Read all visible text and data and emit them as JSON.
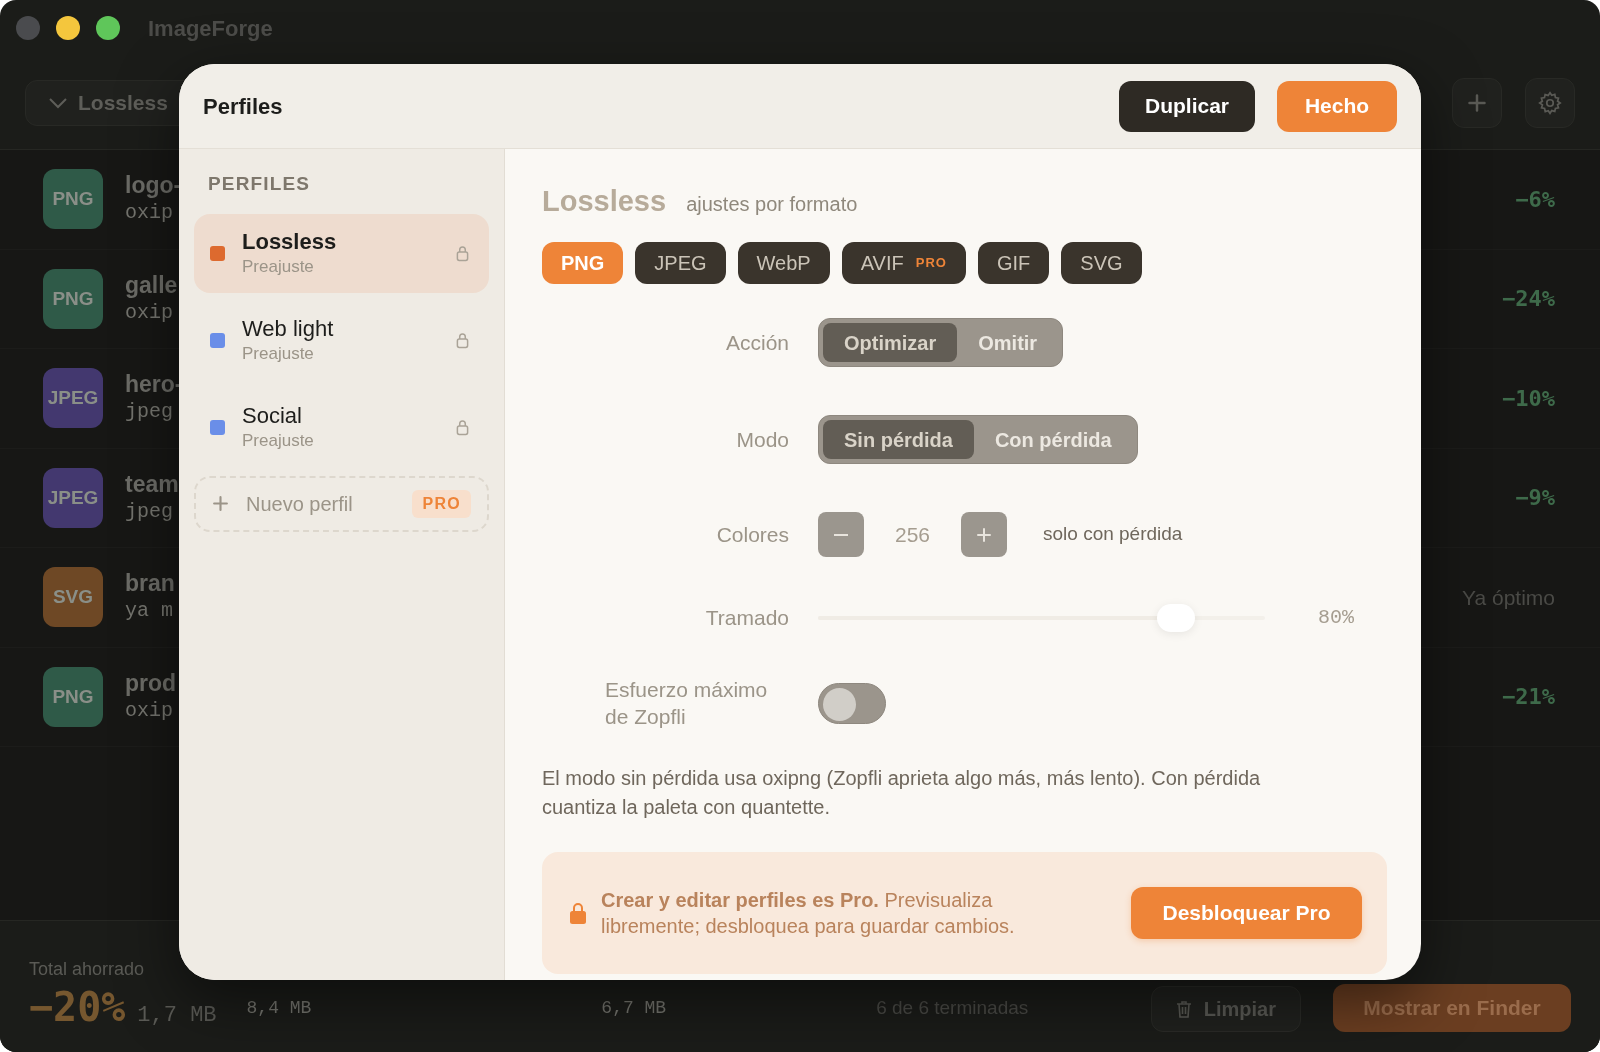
{
  "window": {
    "title": "ImageForge"
  },
  "toolbar": {
    "profile_dropdown": "Lossless"
  },
  "files": [
    {
      "badge": "PNG",
      "color": "#2f5a48",
      "name": "logo-",
      "detail": "oxip",
      "result": "−6%",
      "kind": "saved"
    },
    {
      "badge": "PNG",
      "color": "#2f5a48",
      "name": "galle",
      "detail": "oxip",
      "result": "−24%",
      "kind": "saved"
    },
    {
      "badge": "JPEG",
      "color": "#43386f",
      "name": "hero-",
      "detail": "jpeg",
      "result": "−10%",
      "kind": "saved"
    },
    {
      "badge": "JPEG",
      "color": "#43386f",
      "name": "team",
      "detail": "jpeg",
      "result": "−9%",
      "kind": "saved"
    },
    {
      "badge": "SVG",
      "color": "#6e4825",
      "name": "bran",
      "detail": "ya m",
      "result": "Ya óptimo",
      "kind": "optimal"
    },
    {
      "badge": "PNG",
      "color": "#2f5a48",
      "name": "prod",
      "detail": "oxip",
      "result": "−21%",
      "kind": "saved"
    }
  ],
  "summary": {
    "label": "Total ahorrado",
    "percent": "−20%",
    "saved": "1,7 MB",
    "original_total": "8,4 MB",
    "optimized_total": "6,7 MB",
    "progress": "6 de 6 terminadas"
  },
  "footer_buttons": {
    "clear": "Limpiar",
    "reveal": "Mostrar en Finder"
  },
  "dialog": {
    "title": "Perfiles",
    "buttons": [
      {
        "label": "Duplicar",
        "kind": "secondary"
      },
      {
        "label": "Hecho",
        "kind": "primary"
      }
    ],
    "sidebar": {
      "heading": "PERFILES",
      "profiles": [
        {
          "name": "Lossless",
          "subtitle": "Preajuste",
          "color": "#dd6a2f",
          "selected": true,
          "locked": true
        },
        {
          "name": "Web light",
          "subtitle": "Preajuste",
          "color": "#6a8ee8",
          "selected": false,
          "locked": true
        },
        {
          "name": "Social",
          "subtitle": "Preajuste",
          "color": "#6a8ee8",
          "selected": false,
          "locked": true
        }
      ],
      "new_profile": {
        "label": "Nuevo perfil",
        "badge": "PRO"
      }
    },
    "editor": {
      "title": "Lossless",
      "subtitle": "ajustes por formato",
      "formats": [
        {
          "label": "PNG",
          "selected": true
        },
        {
          "label": "JPEG",
          "selected": false
        },
        {
          "label": "WebP",
          "selected": false
        },
        {
          "label": "AVIF",
          "selected": false,
          "badge": "PRO"
        },
        {
          "label": "GIF",
          "selected": false
        },
        {
          "label": "SVG",
          "selected": false
        }
      ],
      "settings": [
        {
          "kind": "segmented",
          "label": "Acción",
          "options": [
            {
              "label": "Optimizar",
              "selected": true
            },
            {
              "label": "Omitir",
              "selected": false
            }
          ]
        },
        {
          "kind": "segmented",
          "label": "Modo",
          "options": [
            {
              "label": "Sin pérdida",
              "selected": true
            },
            {
              "label": "Con pérdida",
              "selected": false
            }
          ]
        },
        {
          "kind": "stepper",
          "label": "Colores",
          "value": "256",
          "note": "solo con pérdida"
        },
        {
          "kind": "slider",
          "label": "Tramado",
          "level": 0.8,
          "reading": "80%"
        },
        {
          "kind": "toggle",
          "label": "Esfuerzo máximo de Zopfli",
          "on": false
        }
      ],
      "description": "El modo sin pérdida usa oxipng (Zopfli aprieta algo más, más lento). Con pérdida cuantiza la paleta con quantette.",
      "pro_banner": {
        "text": "**Crear y editar perfiles es Pro.**  Previsualiza libremente; desbloquea para guardar cambios.",
        "button": "Desbloquear Pro"
      }
    }
  }
}
